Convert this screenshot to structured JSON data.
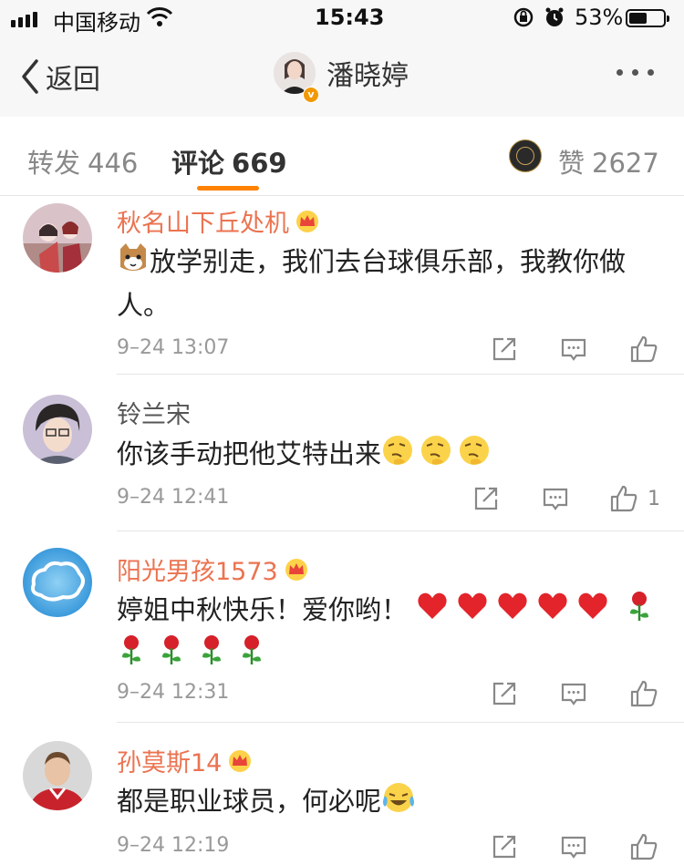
{
  "status_bar": {
    "carrier": "中国移动",
    "time": "15:43",
    "battery_pct": "53%",
    "battery_level": 0.53
  },
  "nav": {
    "back_label": "返回",
    "title": "潘晓婷",
    "verified_badge": "v"
  },
  "tabs": [
    {
      "label": "转发",
      "count": "446"
    },
    {
      "label": "评论",
      "count": "669"
    }
  ],
  "likes": {
    "label": "赞",
    "count": "2627"
  },
  "comments": [
    {
      "name": "秋名山下丘处机",
      "vip": true,
      "text": "放学别走，我们去台球俱乐部，我教你做人。",
      "time": "9–24 13:07",
      "like_count": ""
    },
    {
      "name": "铃兰宋",
      "vip": false,
      "text": "你该手动把他艾特出来",
      "time": "9–24 12:41",
      "like_count": "1"
    },
    {
      "name": "阳光男孩1573",
      "vip": true,
      "text": "婷姐中秋快乐！爱你哟！",
      "time": "9–24 12:31",
      "like_count": ""
    },
    {
      "name": "孙莫斯14",
      "vip": true,
      "text": "都是职业球员，何必呢",
      "time": "9–24 12:19",
      "like_count": ""
    }
  ],
  "colors": {
    "accent": "#ff8200",
    "vip_name": "#eb7350"
  },
  "icons": [
    "signal-icon",
    "wifi-icon",
    "rotation-lock-icon",
    "alarm-icon",
    "battery-icon",
    "back-chevron-icon",
    "more-icon",
    "share-icon",
    "comment-icon",
    "like-icon",
    "crown-icon"
  ]
}
